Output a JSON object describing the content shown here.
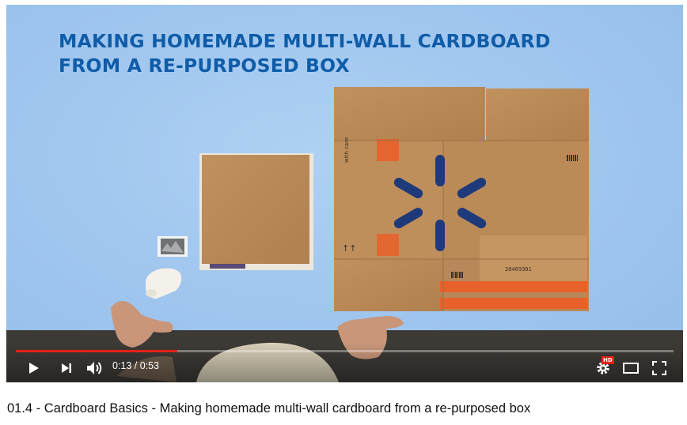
{
  "video": {
    "overlay_title_line1": "MAKING HOMEMADE MULTI-WALL CARDBOARD",
    "overlay_title_line2": "FROM A RE-PURPOSED BOX",
    "box_print_with_care": "with care",
    "box_print_code": "20469301",
    "box_print_arrows": "↑↑"
  },
  "player": {
    "progress_fraction": 0.246,
    "current_time": "0:13",
    "duration": "0:53",
    "time_display": "0:13 / 0:53",
    "hd_badge": "HD",
    "colors": {
      "progress": "#e62117",
      "badge": "#e62117",
      "controls_icons": "#ffffff"
    },
    "controls": [
      "play-icon",
      "next-icon",
      "volume-icon",
      "settings-gear-icon",
      "theater-mode-icon",
      "fullscreen-icon"
    ]
  },
  "page": {
    "video_title": "01.4 - Cardboard Basics - Making homemade multi-wall cardboard from a re-purposed box"
  },
  "colors": {
    "background": "#9cc4ee",
    "title": "#0f5ca8",
    "cardboard": "#b8895a",
    "logo": "#1e3a7a",
    "tape": "#e8602a"
  }
}
